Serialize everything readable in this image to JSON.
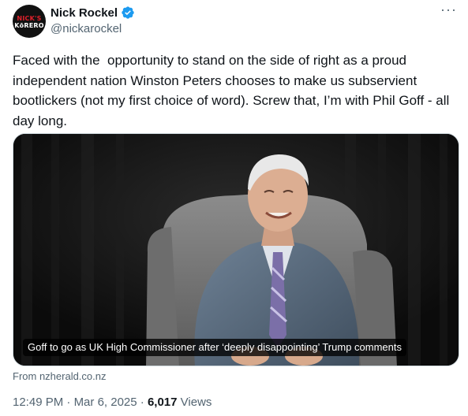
{
  "author": {
    "display_name": "Nick Rockel",
    "handle": "@nickarockel",
    "avatar_text_top": "NICK'S",
    "avatar_text_bottom": "KōRERO",
    "verified_color": "#1d9bf0"
  },
  "tweet": {
    "text": "Faced with the  opportunity to stand on the side of right as a proud independent nation Winston Peters chooses to make us subservient bootlickers (not my first choice of word). Screw that, I’m with Phil Goff - all day long."
  },
  "link_card": {
    "title": "Goff to go as UK High Commissioner after ‘deeply disappointing’ Trump comments",
    "source": "From nzherald.co.nz"
  },
  "meta": {
    "time": "12:49 PM",
    "separator1": " · ",
    "date": "Mar 6, 2025",
    "separator2": " · ",
    "views_count": "6,017",
    "views_label": " Views"
  },
  "icons": {
    "more": "more-horizontal-icon",
    "verified": "verified-badge-icon"
  }
}
